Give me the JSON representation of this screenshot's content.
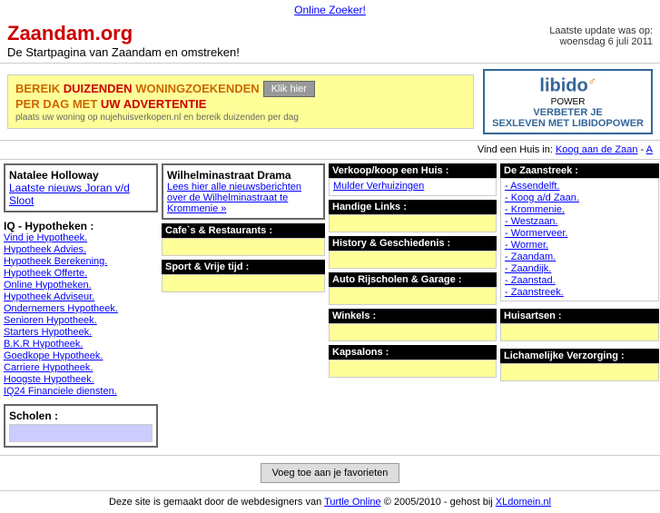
{
  "top_link": "Online Zoeker!",
  "top_link_url": "#",
  "header": {
    "title": "Zaandam.org",
    "subtitle": "De Startpagina van Zaandam en omstreken!",
    "update_label": "Laatste update was op:",
    "update_date": "woensdag 6 juli 2011"
  },
  "banner": {
    "left_line1_pre": "BEREIK ",
    "left_line1_highlight": "DUIZENDEN",
    "left_line1_mid": " WONINGZOEKENDEN",
    "left_line2_pre": "PER DAG MET ",
    "left_line2_highlight": "UW ADVERTENTIE",
    "left_btn": "Klik hier",
    "left_sub": "plaats uw woning op nujehuisverkopen.nl en bereik duizenden per dag",
    "right_brand": "libido",
    "right_brand_super": "♂",
    "right_sub1": "POWER",
    "right_tagline": "VERBETER JE",
    "right_tagline2": "SEXLEVEN MET LIBIDOPOWER"
  },
  "find_house": {
    "label": "Vind een Huis in:",
    "link1": "Koog aan de Zaan",
    "link2": "·",
    "link3": "A"
  },
  "col1": {
    "person_name": "Natalee Holloway",
    "person_link": "Laatste nieuws Joran v/d Sloot",
    "iq_header": "IQ - Hypotheken :",
    "links": [
      "Vind je Hypotheek.",
      "Hypotheek Advies.",
      "Hypotheek Berekening.",
      "Hypotheek Offerte.",
      "Online Hypotheken.",
      "Hypotheek Adviseur.",
      "Ondernemers Hypotheek.",
      "Senioren Hypotheek.",
      "Starters Hypotheek.",
      "B.K.R Hypotheek.",
      "Goedkope Hypotheek.",
      "Carriere Hypotheek.",
      "Hoogste Hypotheek.",
      "IQ24 Financiele diensten."
    ],
    "scholen_label": "Scholen :"
  },
  "col2": {
    "wilhelmina_header": "Wilhelminastraat Drama",
    "wilhelmina_text": "Lees hier alle nieuwsberichten over de Wilhelminastraat te Krommenie »",
    "cafes_header": "Cafe`s & Restaurants :",
    "sport_header": "Sport & Vrije tijd :"
  },
  "col3": {
    "verkoop_header": "Verkoop/koop een Huis :",
    "verkoop_link": "Mulder Verhuizingen",
    "handige_header": "Handige Links :",
    "history_header": "History & Geschiedenis :",
    "auto_header": "Auto Rijscholen & Garage :",
    "winkels_header": "Winkels :",
    "kapsalons_header": "Kapsalons :"
  },
  "col4": {
    "zaanstreek_header": "De Zaanstreek :",
    "zaanstreek_links": [
      "Assendelft.",
      "Koog a/d Zaan.",
      "Krommenie.",
      "Westzaan.",
      "Wormerveer.",
      "Wormer.",
      "Zaandam.",
      "Zaandijk.",
      "Zaanstad.",
      "Zaanstreek."
    ],
    "huisartsen_header": "Huisartsen :",
    "lich_header": "Lichamelijke Verzorging :"
  },
  "bottom_btn": "Voeg toe aan je favorieten",
  "footer": {
    "text_pre": "Deze site is gemaakt door de webdesigners van ",
    "turtle_link": "Turtle Online",
    "text_mid": " © 2005/2010 - gehost bij ",
    "xl_link": "XLdomein.nl"
  }
}
